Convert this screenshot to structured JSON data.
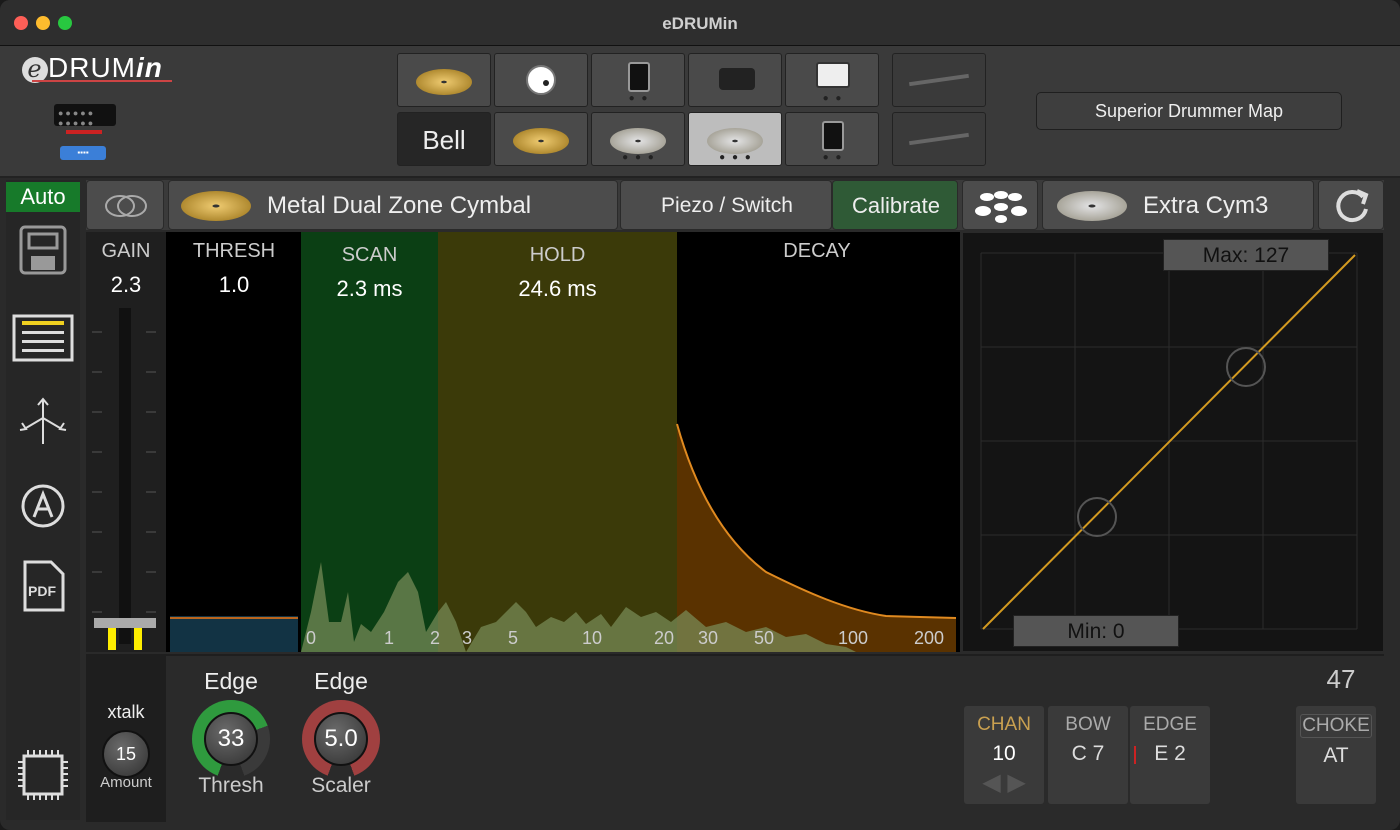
{
  "window": {
    "title": "eDRUMin"
  },
  "logo": {
    "text": "DRUM",
    "suffix": "in",
    "e": "e"
  },
  "header": {
    "row2_first_pad": "Bell",
    "map_button": "Superior Drummer Map"
  },
  "sidebar": {
    "auto": "Auto"
  },
  "toolbar": {
    "pad_type": "Metal Dual Zone Cymbal",
    "sensor": "Piezo / Switch",
    "calibrate": "Calibrate",
    "instrument": "Extra Cym3"
  },
  "params": {
    "gain_label": "GAIN",
    "gain_value": "2.3",
    "thresh_label": "THRESH",
    "thresh_value": "1.0",
    "scan_label": "SCAN",
    "scan_value": "2.3 ms",
    "hold_label": "HOLD",
    "hold_value": "24.6 ms",
    "decay_label": "DECAY"
  },
  "axis_ticks": [
    "0",
    "1",
    "2",
    "3",
    "5",
    "10",
    "20",
    "30",
    "50",
    "100",
    "200"
  ],
  "curve": {
    "max_label": "Max: 127",
    "min_label": "Min: 0"
  },
  "bottom": {
    "xtalk_label": "xtalk",
    "xtalk_value": "15",
    "xtalk_sub": "Amount",
    "edge1_title": "Edge",
    "edge1_value": "33",
    "edge1_sub": "Thresh",
    "edge2_title": "Edge",
    "edge2_value": "5.0",
    "edge2_sub": "Scaler",
    "note_number": "47",
    "chan_label": "CHAN",
    "chan_value": "10",
    "bow_label": "BOW",
    "bow_value": "C 7",
    "edge_label": "EDGE",
    "edge_value": "E 2",
    "choke_label": "CHOKE",
    "choke_value": "AT"
  }
}
